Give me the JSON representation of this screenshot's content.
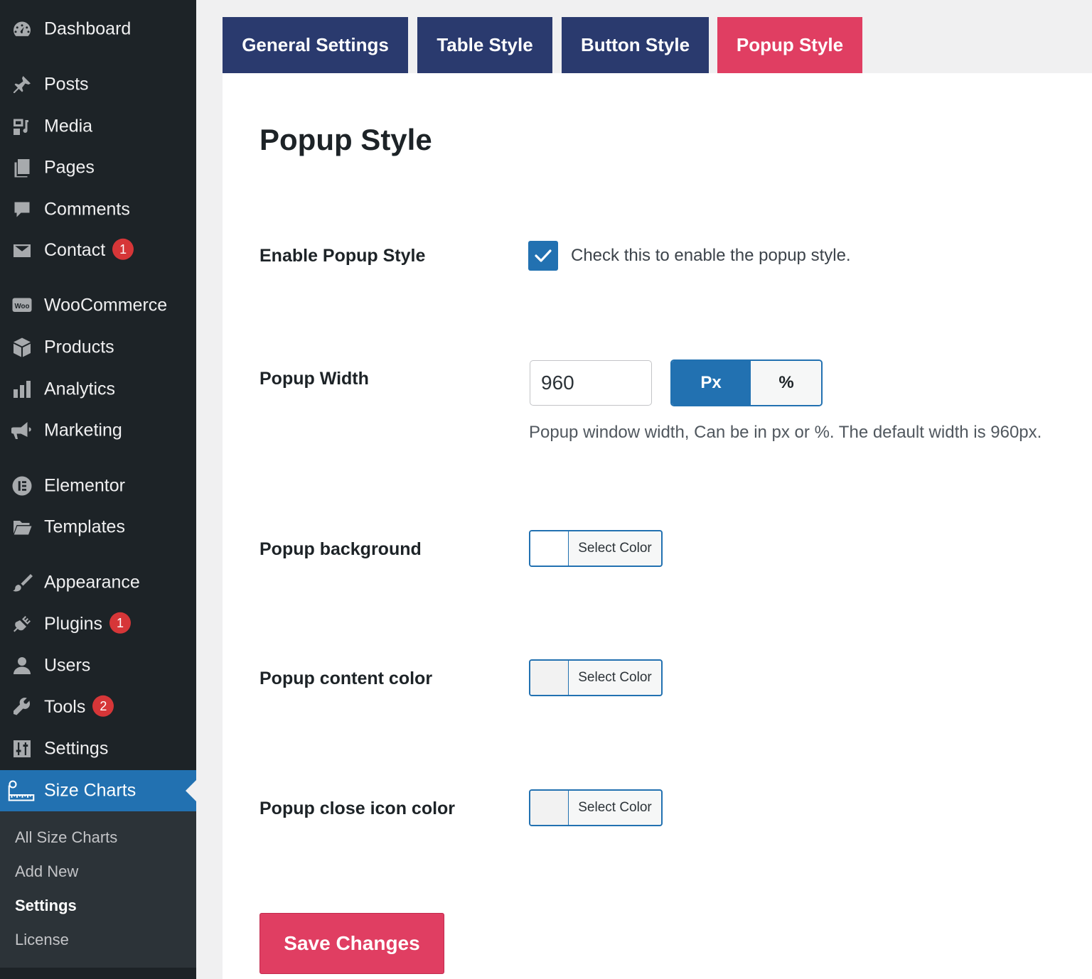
{
  "sidebar": {
    "items": [
      {
        "label": "Dashboard",
        "icon": "dashboard-icon",
        "badge": null
      },
      {
        "label": "Posts",
        "icon": "pushpin-icon",
        "badge": null
      },
      {
        "label": "Media",
        "icon": "media-icon",
        "badge": null
      },
      {
        "label": "Pages",
        "icon": "pages-icon",
        "badge": null
      },
      {
        "label": "Comments",
        "icon": "comment-bubble-icon",
        "badge": null
      },
      {
        "label": "Contact",
        "icon": "envelope-icon",
        "badge": "1"
      },
      {
        "label": "WooCommerce",
        "icon": "woo-icon",
        "badge": null
      },
      {
        "label": "Products",
        "icon": "box-icon",
        "badge": null
      },
      {
        "label": "Analytics",
        "icon": "bar-chart-icon",
        "badge": null
      },
      {
        "label": "Marketing",
        "icon": "megaphone-icon",
        "badge": null
      },
      {
        "label": "Elementor",
        "icon": "elementor-icon",
        "badge": null
      },
      {
        "label": "Templates",
        "icon": "folder-icon",
        "badge": null
      },
      {
        "label": "Appearance",
        "icon": "paintbrush-icon",
        "badge": null
      },
      {
        "label": "Plugins",
        "icon": "plug-icon",
        "badge": "1"
      },
      {
        "label": "Users",
        "icon": "user-icon",
        "badge": null
      },
      {
        "label": "Tools",
        "icon": "wrench-icon",
        "badge": "2"
      },
      {
        "label": "Settings",
        "icon": "sliders-icon",
        "badge": null
      },
      {
        "label": "Size Charts",
        "icon": "ruler-icon",
        "badge": null
      }
    ],
    "submenu": [
      "All Size Charts",
      "Add New",
      "Settings",
      "License"
    ]
  },
  "tabs": [
    "General Settings",
    "Table Style",
    "Button Style",
    "Popup Style"
  ],
  "page_title": "Popup Style",
  "enable_popup": {
    "label": "Enable Popup Style",
    "checked": true,
    "description": "Check this to enable the popup style."
  },
  "popup_width": {
    "label": "Popup Width",
    "value": "960",
    "units": [
      "Px",
      "%"
    ],
    "selected_unit": "Px",
    "description": "Popup window width, Can be in px or %. The default width is 960px."
  },
  "popup_background": {
    "label": "Popup background",
    "button": "Select Color"
  },
  "popup_content_color": {
    "label": "Popup content color",
    "button": "Select Color"
  },
  "popup_close_icon_color": {
    "label": "Popup close icon color",
    "button": "Select Color"
  },
  "save_button": "Save Changes",
  "colors": {
    "sidebar_bg": "#1d2327",
    "accent_blue": "#2271b1",
    "tab_navy": "#2a3a6e",
    "tab_active": "#e03e62",
    "badge": "#d63638"
  }
}
